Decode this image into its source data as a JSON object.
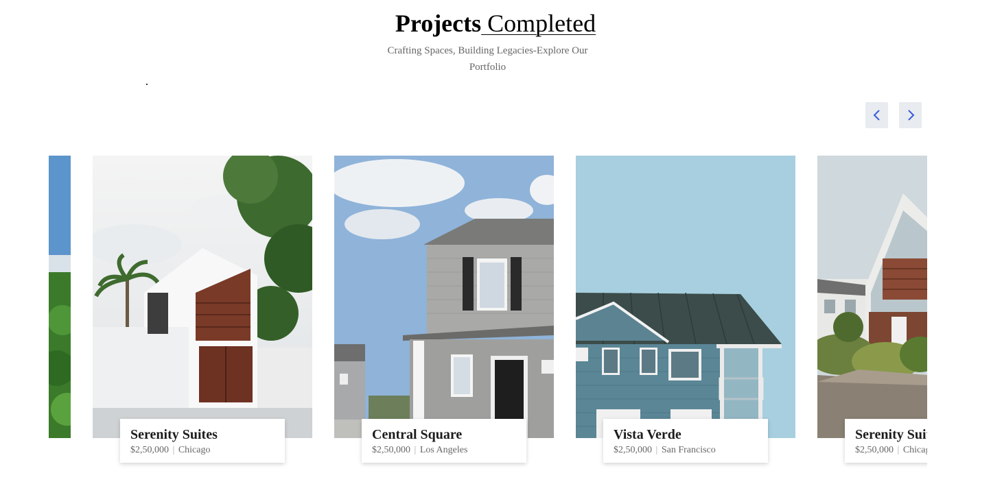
{
  "header": {
    "title_bold": "Projects",
    "title_underlined": " Completed",
    "subtitle": "Crafting Spaces, Building Legacies-Explore Our Portfolio"
  },
  "carousel": {
    "prev_icon": "chevron-left-icon",
    "next_icon": "chevron-right-icon",
    "accent": "#3b5bdb",
    "button_bg": "#e8ebef"
  },
  "projects": [
    {
      "name": "Serenity Suites",
      "price": "$2,50,000",
      "location": "Chicago"
    },
    {
      "name": "Central Square",
      "price": "$2,50,000",
      "location": "Los Angeles"
    },
    {
      "name": "Vista Verde",
      "price": "$2,50,000",
      "location": "San Francisco"
    },
    {
      "name": "Serenity Suites",
      "price": "$2,50,000",
      "location": "Chicago"
    }
  ]
}
